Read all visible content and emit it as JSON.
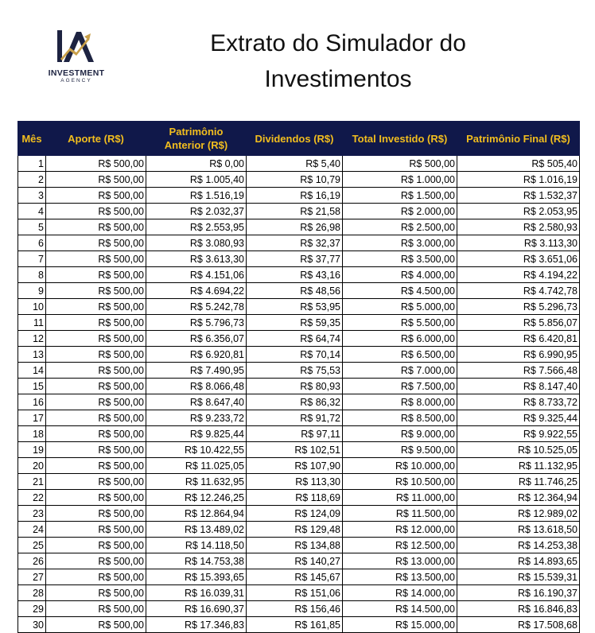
{
  "logo": {
    "name": "INVESTMENT",
    "sub": "AGENCY"
  },
  "title": "Extrato do Simulador do Investimentos",
  "colors": {
    "header_bg": "#10184a",
    "header_text": "#f2be1e"
  },
  "headers": [
    "Mês",
    "Aporte (R$)",
    "Patrimônio Anterior (R$)",
    "Dividendos (R$)",
    "Total Investido (R$)",
    "Patrimônio Final (R$)"
  ],
  "rows": [
    [
      "1",
      "R$ 500,00",
      "R$ 0,00",
      "R$ 5,40",
      "R$ 500,00",
      "R$ 505,40"
    ],
    [
      "2",
      "R$ 500,00",
      "R$ 1.005,40",
      "R$ 10,79",
      "R$ 1.000,00",
      "R$ 1.016,19"
    ],
    [
      "3",
      "R$ 500,00",
      "R$ 1.516,19",
      "R$ 16,19",
      "R$ 1.500,00",
      "R$ 1.532,37"
    ],
    [
      "4",
      "R$ 500,00",
      "R$ 2.032,37",
      "R$ 21,58",
      "R$ 2.000,00",
      "R$ 2.053,95"
    ],
    [
      "5",
      "R$ 500,00",
      "R$ 2.553,95",
      "R$ 26,98",
      "R$ 2.500,00",
      "R$ 2.580,93"
    ],
    [
      "6",
      "R$ 500,00",
      "R$ 3.080,93",
      "R$ 32,37",
      "R$ 3.000,00",
      "R$ 3.113,30"
    ],
    [
      "7",
      "R$ 500,00",
      "R$ 3.613,30",
      "R$ 37,77",
      "R$ 3.500,00",
      "R$ 3.651,06"
    ],
    [
      "8",
      "R$ 500,00",
      "R$ 4.151,06",
      "R$ 43,16",
      "R$ 4.000,00",
      "R$ 4.194,22"
    ],
    [
      "9",
      "R$ 500,00",
      "R$ 4.694,22",
      "R$ 48,56",
      "R$ 4.500,00",
      "R$ 4.742,78"
    ],
    [
      "10",
      "R$ 500,00",
      "R$ 5.242,78",
      "R$ 53,95",
      "R$ 5.000,00",
      "R$ 5.296,73"
    ],
    [
      "11",
      "R$ 500,00",
      "R$ 5.796,73",
      "R$ 59,35",
      "R$ 5.500,00",
      "R$ 5.856,07"
    ],
    [
      "12",
      "R$ 500,00",
      "R$ 6.356,07",
      "R$ 64,74",
      "R$ 6.000,00",
      "R$ 6.420,81"
    ],
    [
      "13",
      "R$ 500,00",
      "R$ 6.920,81",
      "R$ 70,14",
      "R$ 6.500,00",
      "R$ 6.990,95"
    ],
    [
      "14",
      "R$ 500,00",
      "R$ 7.490,95",
      "R$ 75,53",
      "R$ 7.000,00",
      "R$ 7.566,48"
    ],
    [
      "15",
      "R$ 500,00",
      "R$ 8.066,48",
      "R$ 80,93",
      "R$ 7.500,00",
      "R$ 8.147,40"
    ],
    [
      "16",
      "R$ 500,00",
      "R$ 8.647,40",
      "R$ 86,32",
      "R$ 8.000,00",
      "R$ 8.733,72"
    ],
    [
      "17",
      "R$ 500,00",
      "R$ 9.233,72",
      "R$ 91,72",
      "R$ 8.500,00",
      "R$ 9.325,44"
    ],
    [
      "18",
      "R$ 500,00",
      "R$ 9.825,44",
      "R$ 97,11",
      "R$ 9.000,00",
      "R$ 9.922,55"
    ],
    [
      "19",
      "R$ 500,00",
      "R$ 10.422,55",
      "R$ 102,51",
      "R$ 9.500,00",
      "R$ 10.525,05"
    ],
    [
      "20",
      "R$ 500,00",
      "R$ 11.025,05",
      "R$ 107,90",
      "R$ 10.000,00",
      "R$ 11.132,95"
    ],
    [
      "21",
      "R$ 500,00",
      "R$ 11.632,95",
      "R$ 113,30",
      "R$ 10.500,00",
      "R$ 11.746,25"
    ],
    [
      "22",
      "R$ 500,00",
      "R$ 12.246,25",
      "R$ 118,69",
      "R$ 11.000,00",
      "R$ 12.364,94"
    ],
    [
      "23",
      "R$ 500,00",
      "R$ 12.864,94",
      "R$ 124,09",
      "R$ 11.500,00",
      "R$ 12.989,02"
    ],
    [
      "24",
      "R$ 500,00",
      "R$ 13.489,02",
      "R$ 129,48",
      "R$ 12.000,00",
      "R$ 13.618,50"
    ],
    [
      "25",
      "R$ 500,00",
      "R$ 14.118,50",
      "R$ 134,88",
      "R$ 12.500,00",
      "R$ 14.253,38"
    ],
    [
      "26",
      "R$ 500,00",
      "R$ 14.753,38",
      "R$ 140,27",
      "R$ 13.000,00",
      "R$ 14.893,65"
    ],
    [
      "27",
      "R$ 500,00",
      "R$ 15.393,65",
      "R$ 145,67",
      "R$ 13.500,00",
      "R$ 15.539,31"
    ],
    [
      "28",
      "R$ 500,00",
      "R$ 16.039,31",
      "R$ 151,06",
      "R$ 14.000,00",
      "R$ 16.190,37"
    ],
    [
      "29",
      "R$ 500,00",
      "R$ 16.690,37",
      "R$ 156,46",
      "R$ 14.500,00",
      "R$ 16.846,83"
    ],
    [
      "30",
      "R$ 500,00",
      "R$ 17.346,83",
      "R$ 161,85",
      "R$ 15.000,00",
      "R$ 17.508,68"
    ]
  ]
}
